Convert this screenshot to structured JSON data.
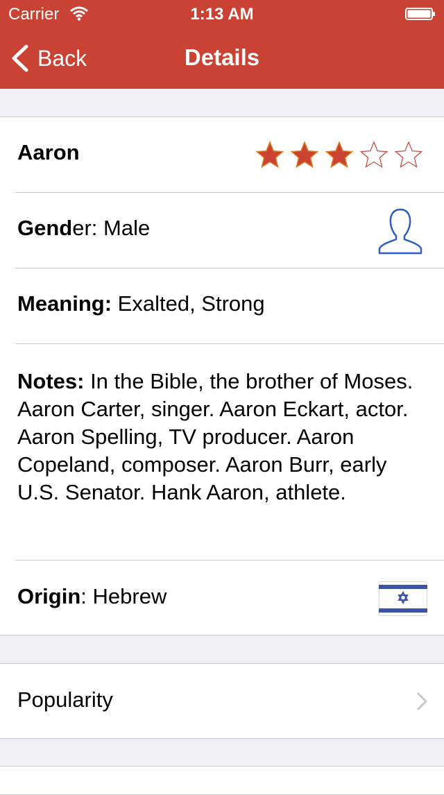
{
  "status_bar": {
    "carrier": "Carrier",
    "time": "1:13 AM"
  },
  "nav": {
    "back_label": "Back",
    "title": "Details"
  },
  "details": {
    "name": "Aaron",
    "rating": {
      "value": 3,
      "max": 5
    },
    "gender": {
      "label_bold": "Gend",
      "label_rest": "er:",
      "value": " Male"
    },
    "meaning": {
      "label": "Meaning:",
      "value": " Exalted, Strong"
    },
    "notes": {
      "label": "Notes:",
      "value": " In the Bible, the brother of Moses.  Aaron Carter, singer. Aaron Eckart, actor. Aaron Spelling, TV producer. Aaron Copeland, composer. Aaron Burr, early U.S. Senator. Hank Aaron, athlete."
    },
    "origin": {
      "label": "Origin",
      "colon": ":",
      "value": " Hebrew"
    }
  },
  "popularity": {
    "label": "Popularity"
  },
  "colors": {
    "nav": "#c94234",
    "star": "#c94234",
    "icon_blue": "#2e5fc0"
  },
  "icons": {
    "gender": "person-outline-icon",
    "origin": "israel-flag-icon"
  }
}
